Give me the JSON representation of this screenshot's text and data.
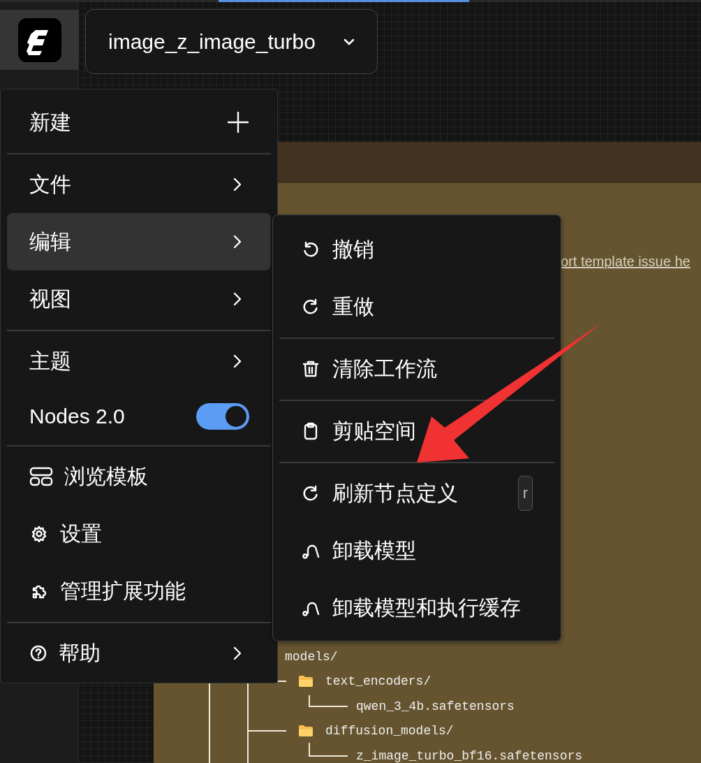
{
  "header": {
    "workflow": "image_z_image_turbo"
  },
  "node": {
    "link": "ort template issue he",
    "tree": {
      "name": "models/",
      "children": [
        {
          "name": "text_encoders/",
          "kind": "folder",
          "children": [
            {
              "name": "qwen_3_4b.safetensors",
              "kind": "file"
            }
          ]
        },
        {
          "name": "diffusion_models/",
          "kind": "folder",
          "children": [
            {
              "name": "z_image_turbo_bf16.safetensors",
              "kind": "file"
            }
          ]
        }
      ]
    }
  },
  "menu": {
    "groups": [
      {
        "items": [
          {
            "kind": "add",
            "label": "新建",
            "selected": false
          }
        ]
      },
      {
        "items": [
          {
            "kind": "submenu",
            "label": "文件",
            "selected": false
          },
          {
            "kind": "submenu",
            "label": "编辑",
            "selected": true
          },
          {
            "kind": "submenu",
            "label": "视图",
            "selected": false
          }
        ]
      },
      {
        "items": [
          {
            "kind": "submenu",
            "label": "主题",
            "selected": false
          },
          {
            "kind": "toggle",
            "label": "Nodes 2.0",
            "on": true
          }
        ]
      },
      {
        "items": [
          {
            "kind": "templates",
            "label": "浏览模板",
            "selected": false
          },
          {
            "kind": "settings",
            "label": "设置",
            "selected": false
          },
          {
            "kind": "extensions",
            "label": "管理扩展功能",
            "selected": false
          }
        ]
      },
      {
        "items": [
          {
            "kind": "help",
            "label": "帮助",
            "selected": false
          }
        ]
      }
    ]
  },
  "submenu": {
    "groups": [
      {
        "items": [
          {
            "kind": "undo",
            "label": "撤销"
          },
          {
            "kind": "redo",
            "label": "重做"
          }
        ]
      },
      {
        "items": [
          {
            "kind": "trash",
            "label": "清除工作流"
          }
        ]
      },
      {
        "items": [
          {
            "kind": "clipboard",
            "label": "剪贴空间"
          }
        ]
      },
      {
        "items": [
          {
            "kind": "refresh",
            "label": "刷新节点定义",
            "shortcut": "r"
          },
          {
            "kind": "unload",
            "label": "卸载模型"
          },
          {
            "kind": "unload",
            "label": "卸载模型和执行缓存"
          }
        ]
      }
    ]
  }
}
